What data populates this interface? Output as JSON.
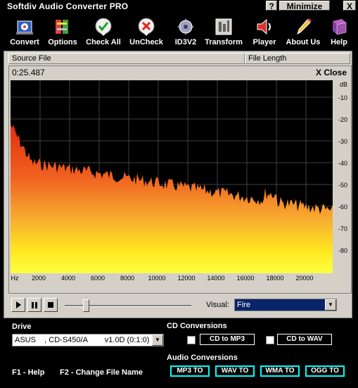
{
  "window": {
    "title": "Softdiv Audio Converter PRO",
    "help_button": "?",
    "minimize_button": "Minimize",
    "close_button": "X"
  },
  "toolbar": [
    {
      "label": "Convert",
      "icon": "convert-icon"
    },
    {
      "label": "Options",
      "icon": "options-icon"
    },
    {
      "label": "Check All",
      "icon": "check-icon"
    },
    {
      "label": "UnCheck",
      "icon": "uncheck-icon"
    },
    {
      "label": "ID3V2",
      "icon": "id3v2-icon"
    },
    {
      "label": "Transform",
      "icon": "transform-icon"
    },
    {
      "label": "Player",
      "icon": "speaker-icon"
    },
    {
      "label": "About Us",
      "icon": "about-icon"
    },
    {
      "label": "Help",
      "icon": "help-book-icon"
    }
  ],
  "file_list": {
    "columns": [
      "Source File",
      "File Length"
    ]
  },
  "visualizer": {
    "time": "0:25.487",
    "close_label": "X Close",
    "db_unit": "dB",
    "db_labels": [
      "-10",
      "-20",
      "-30",
      "-40",
      "-50",
      "-60",
      "-70",
      "-80"
    ],
    "hz_unit": "Hz",
    "hz_labels": [
      "2000",
      "4000",
      "6000",
      "8000",
      "10000",
      "12000",
      "14000",
      "16000",
      "18000",
      "20000"
    ]
  },
  "player": {
    "visual_label": "Visual:",
    "visual_value": "Fire",
    "position_fraction": 0.15
  },
  "drive": {
    "label": "Drive",
    "value": "ASUS    , CD-S450/A        v1.0D (0:1:0)"
  },
  "cd_conversions": {
    "label": "CD Conversions",
    "buttons": [
      "CD to MP3",
      "CD to WAV"
    ]
  },
  "audio_conversions": {
    "label": "Audio Conversions",
    "buttons": [
      "MP3 TO",
      "WAV TO",
      "WMA TO",
      "OGG TO"
    ]
  },
  "hotkeys": {
    "f1": "F1 - Help",
    "f2": "F2 - Change File Name"
  },
  "colors": {
    "background": "#000000",
    "panel": "#d4d0c8",
    "selection": "#0a246a",
    "audio_button_border": "#00ffff"
  }
}
